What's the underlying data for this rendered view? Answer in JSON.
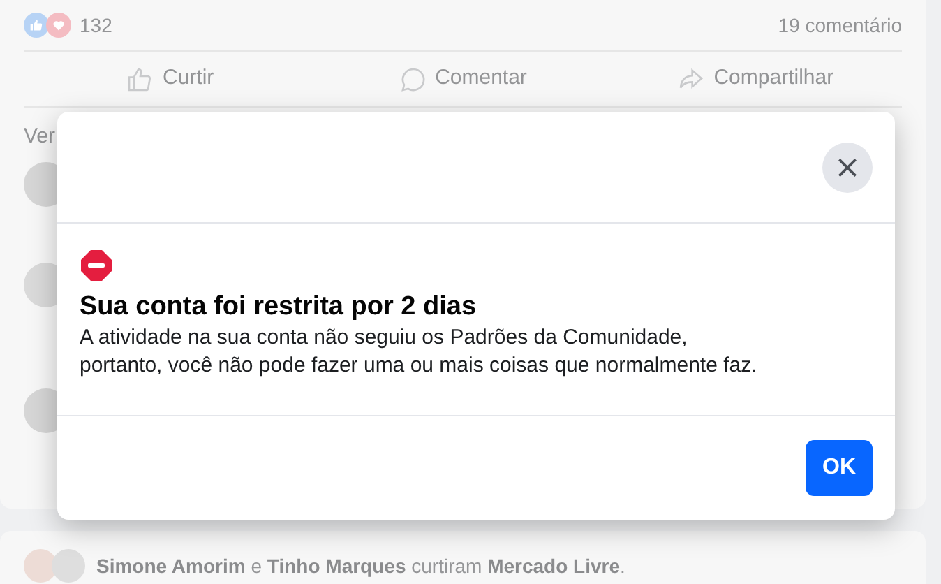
{
  "post": {
    "reaction_count": "132",
    "comment_count": "19 comentário",
    "actions": [
      {
        "kind": "like",
        "label": "Curtir"
      },
      {
        "kind": "comment",
        "label": "Comentar"
      },
      {
        "kind": "share",
        "label": "Compartilhar"
      }
    ],
    "comments_link": "Ver"
  },
  "activity": {
    "text": "**Simone Amorim** e **Tinho Marques** curtiram **Mercado Livre**."
  },
  "dialog": {
    "title": "Sua conta foi restrita por 2 dias",
    "message": "A atividade na sua conta não seguiu os Padrões da Comunidade, portanto, você não pode fazer uma ou mais coisas que normalmente faz.",
    "confirm": "OK"
  }
}
